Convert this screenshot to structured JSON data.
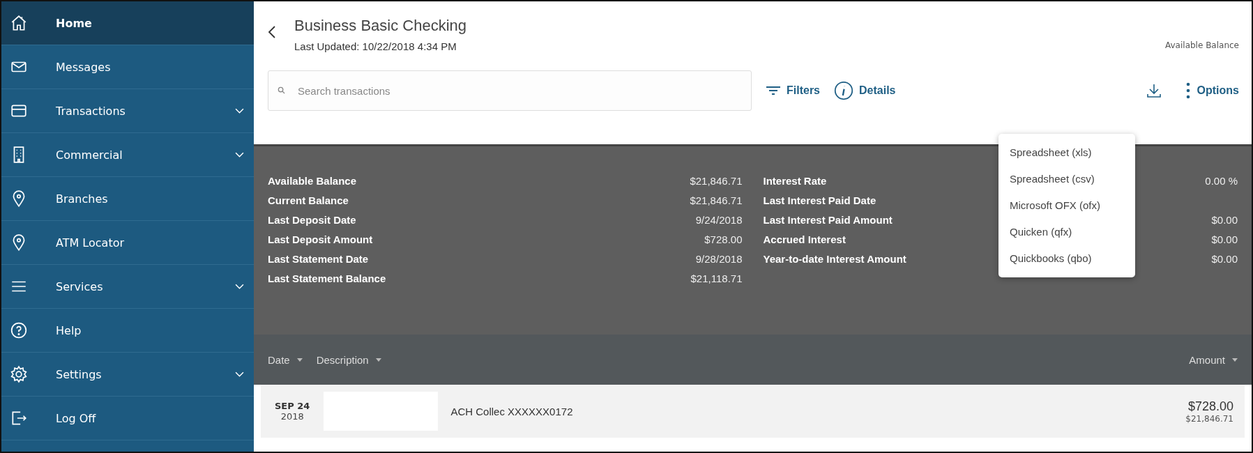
{
  "sidebar": {
    "items": [
      {
        "label": "Home",
        "selected": true,
        "expandable": false
      },
      {
        "label": "Messages",
        "selected": false,
        "expandable": false
      },
      {
        "label": "Transactions",
        "selected": false,
        "expandable": true
      },
      {
        "label": "Commercial",
        "selected": false,
        "expandable": true
      },
      {
        "label": "Branches",
        "selected": false,
        "expandable": false
      },
      {
        "label": "ATM Locator",
        "selected": false,
        "expandable": false
      },
      {
        "label": "Services",
        "selected": false,
        "expandable": true
      },
      {
        "label": "Help",
        "selected": false,
        "expandable": false
      },
      {
        "label": "Settings",
        "selected": false,
        "expandable": true
      },
      {
        "label": "Log Off",
        "selected": false,
        "expandable": false
      }
    ]
  },
  "header": {
    "title": "Business Basic Checking",
    "last_updated": "Last Updated: 10/22/2018 4:34 PM",
    "balance_label": "Available Balance"
  },
  "search": {
    "placeholder": "Search transactions"
  },
  "toolbar": {
    "filters": "Filters",
    "details": "Details",
    "options": "Options"
  },
  "download_menu": [
    "Spreadsheet (xls)",
    "Spreadsheet (csv)",
    "Microsoft OFX (ofx)",
    "Quicken (qfx)",
    "Quickbooks (qbo)"
  ],
  "summary": {
    "left": [
      {
        "label": "Available Balance",
        "value": "$21,846.71"
      },
      {
        "label": "Current Balance",
        "value": "$21,846.71"
      },
      {
        "label": "Last Deposit Date",
        "value": "9/24/2018"
      },
      {
        "label": "Last Deposit Amount",
        "value": "$728.00"
      },
      {
        "label": "Last Statement Date",
        "value": "9/28/2018"
      },
      {
        "label": "Last Statement Balance",
        "value": "$21,118.71"
      }
    ],
    "right": [
      {
        "label": "Interest Rate",
        "value": "0.00 %"
      },
      {
        "label": "Last Interest Paid Date"
      },
      {
        "label": "Last Interest Paid Amount",
        "value": "$0.00"
      },
      {
        "label": "Accrued Interest",
        "value": "$0.00"
      },
      {
        "label": "Year-to-date Interest Amount",
        "value": "$0.00"
      }
    ]
  },
  "table": {
    "columns": [
      "Date",
      "Description",
      "Amount"
    ],
    "rows": [
      {
        "month_day": "SEP 24",
        "year": "2018",
        "description": "ACH Collec XXXXXX0172",
        "amount": "$728.00",
        "balance": "$21,846.71"
      }
    ]
  }
}
